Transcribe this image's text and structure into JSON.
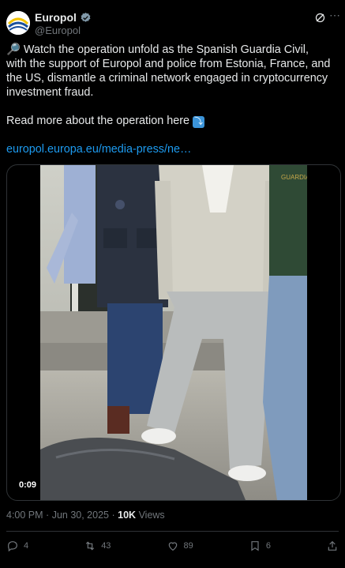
{
  "account": {
    "name": "Europol",
    "handle": "@Europol"
  },
  "post": {
    "emoji": "🔎",
    "line1": "Watch the operation unfold as the Spanish Guardia Civil, with the support of Europol and police from Estonia, France, and the US, dismantle a criminal network engaged in cryptocurrency investment fraud.",
    "line2": "Read more about the operation here",
    "line2_emoji": "⤵",
    "link": "europol.europa.eu/media-press/ne…"
  },
  "video": {
    "duration": "0:09",
    "vest_text": "GUARDIA CIVIL"
  },
  "meta": {
    "time": "4:00 PM",
    "sep1": "·",
    "date": "Jun 30, 2025",
    "sep2": "·",
    "views_count": "10K",
    "views_label": "Views"
  },
  "actions": {
    "replies": "4",
    "reposts": "43",
    "likes": "89",
    "bookmarks": "6"
  },
  "colors": {
    "link": "#1d9bf0",
    "verified": "#829aab",
    "muted": "#71767b",
    "text": "#e7e9ea"
  }
}
